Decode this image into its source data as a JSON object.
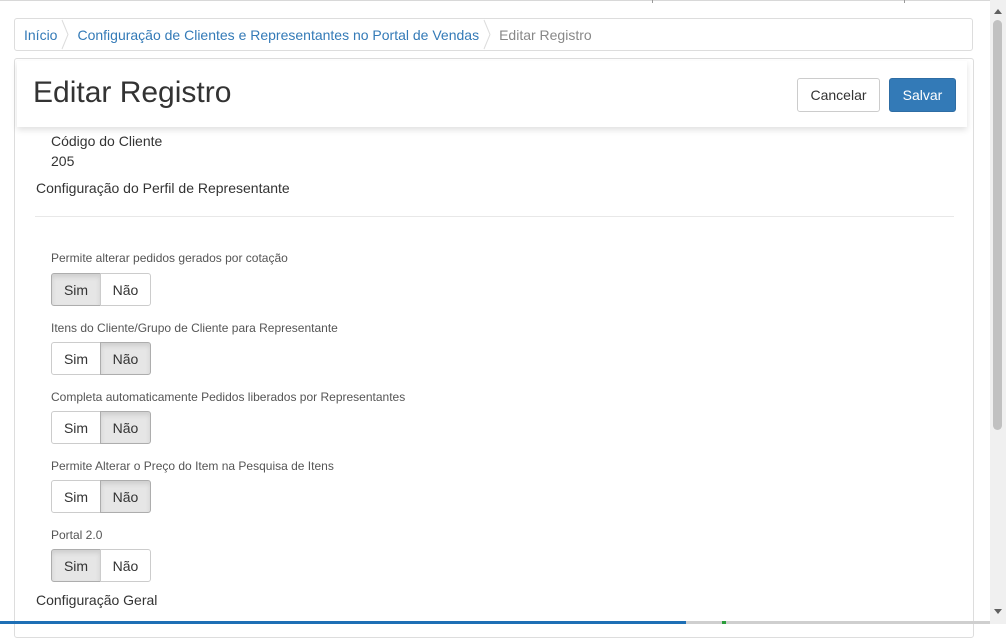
{
  "breadcrumb": {
    "items": [
      {
        "label": "Início"
      },
      {
        "label": "Configuração de Clientes e Representantes no Portal de Vendas"
      }
    ],
    "current": "Editar Registro"
  },
  "header": {
    "title": "Editar Registro",
    "cancel_label": "Cancelar",
    "save_label": "Salvar"
  },
  "client": {
    "code_label": "Código do Cliente",
    "code_value": "205"
  },
  "sections": {
    "representative_profile": "Configuração do Perfil de Representante",
    "general": "Configuração Geral"
  },
  "options": [
    {
      "label": "Permite alterar pedidos gerados por cotação",
      "yes": "Sim",
      "no": "Não",
      "selected": "Sim"
    },
    {
      "label": "Itens do Cliente/Grupo de Cliente para Representante",
      "yes": "Sim",
      "no": "Não",
      "selected": "Não"
    },
    {
      "label": "Completa automaticamente Pedidos liberados por Representantes",
      "yes": "Sim",
      "no": "Não",
      "selected": "Não"
    },
    {
      "label": "Permite Alterar o Preço do Item na Pesquisa de Itens",
      "yes": "Sim",
      "no": "Não",
      "selected": "Não"
    },
    {
      "label": "Portal 2.0",
      "yes": "Sim",
      "no": "Não",
      "selected": "Sim"
    }
  ],
  "colors": {
    "link": "#337ab7",
    "primary": "#337ab7",
    "active_toggle": "#e6e6e6"
  },
  "icons": {
    "breadcrumb_separator": "chevron-right-icon",
    "scroll_up": "arrow-up-icon",
    "scroll_down": "arrow-down-icon"
  }
}
